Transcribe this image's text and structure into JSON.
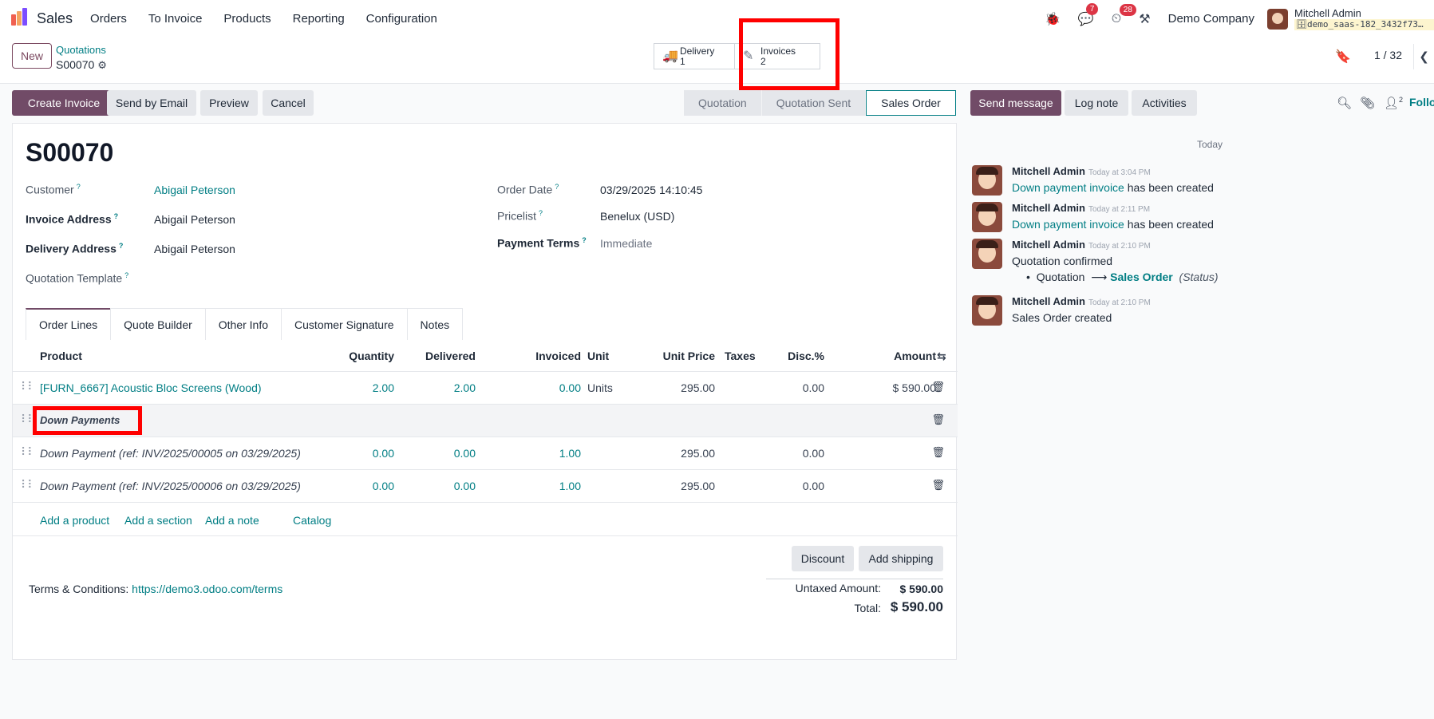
{
  "navbar": {
    "app_name": "Sales",
    "menus": [
      "Orders",
      "To Invoice",
      "Products",
      "Reporting",
      "Configuration"
    ],
    "messages_count": "7",
    "activities_count": "28",
    "company": "Demo Company",
    "user_name": "Mitchell Admin",
    "database": "demo_saas-182_3432f73…"
  },
  "control": {
    "new_label": "New",
    "breadcrumb_parent": "Quotations",
    "record_name": "S00070",
    "delivery_label": "Delivery",
    "delivery_count": "1",
    "invoices_label": "Invoices",
    "invoices_count": "2",
    "pager": "1 / 32"
  },
  "actions": {
    "create_invoice": "Create Invoice",
    "send_email": "Send by Email",
    "preview": "Preview",
    "cancel": "Cancel",
    "stages": [
      "Quotation",
      "Quotation Sent",
      "Sales Order"
    ],
    "active_stage": "Sales Order"
  },
  "chatter_actions": {
    "send_message": "Send message",
    "log_note": "Log note",
    "activities": "Activities",
    "followers_count": "2",
    "follow": "Follo"
  },
  "form": {
    "title": "S00070",
    "customer_label": "Customer",
    "customer": "Abigail Peterson",
    "invoice_address_label": "Invoice Address",
    "invoice_address": "Abigail Peterson",
    "delivery_address_label": "Delivery Address",
    "delivery_address": "Abigail Peterson",
    "quotation_template_label": "Quotation Template",
    "order_date_label": "Order Date",
    "order_date": "03/29/2025 14:10:45",
    "pricelist_label": "Pricelist",
    "pricelist": "Benelux (USD)",
    "payment_terms_label": "Payment Terms",
    "payment_terms": "Immediate"
  },
  "tabs": [
    "Order Lines",
    "Quote Builder",
    "Other Info",
    "Customer Signature",
    "Notes"
  ],
  "table": {
    "headers": {
      "product": "Product",
      "quantity": "Quantity",
      "delivered": "Delivered",
      "invoiced": "Invoiced",
      "unit": "Unit",
      "unit_price": "Unit Price",
      "taxes": "Taxes",
      "disc": "Disc.%",
      "amount": "Amount"
    },
    "rows": [
      {
        "product": "[FURN_6667] Acoustic Bloc Screens (Wood)",
        "quantity": "2.00",
        "delivered": "2.00",
        "invoiced": "0.00",
        "unit": "Units",
        "unit_price": "295.00",
        "disc": "0.00",
        "amount": "$ 590.00"
      },
      {
        "section": "Down Payments"
      },
      {
        "product": "Down Payment (ref: INV/2025/00005 on 03/29/2025)",
        "quantity": "0.00",
        "delivered": "0.00",
        "invoiced": "1.00",
        "unit_price": "295.00",
        "disc": "0.00"
      },
      {
        "product": "Down Payment (ref: INV/2025/00006 on 03/29/2025)",
        "quantity": "0.00",
        "delivered": "0.00",
        "invoiced": "1.00",
        "unit_price": "295.00",
        "disc": "0.00"
      }
    ],
    "add_product": "Add a product",
    "add_section": "Add a section",
    "add_note": "Add a note",
    "catalog": "Catalog"
  },
  "footer": {
    "discount": "Discount",
    "add_shipping": "Add shipping",
    "terms_label": "Terms & Conditions:",
    "terms_link": "https://demo3.odoo.com/terms",
    "untaxed_label": "Untaxed Amount:",
    "untaxed_value": "$ 590.00",
    "total_label": "Total:",
    "total_value": "$ 590.00"
  },
  "chatter": {
    "today": "Today",
    "messages": [
      {
        "author": "Mitchell Admin",
        "date": "Today at 3:04 PM",
        "link": "Down payment invoice",
        "text": "has been created"
      },
      {
        "author": "Mitchell Admin",
        "date": "Today at 2:11 PM",
        "link": "Down payment invoice",
        "text": "has been created"
      },
      {
        "author": "Mitchell Admin",
        "date": "Today at 2:10 PM",
        "text": "Quotation confirmed",
        "change_from": "Quotation",
        "change_to": "Sales Order",
        "change_field": "(Status)"
      },
      {
        "author": "Mitchell Admin",
        "date": "Today at 2:10 PM",
        "text": "Sales Order created"
      }
    ]
  },
  "colors": {
    "primary": "#714b67",
    "link": "#017e84",
    "badge": "#dc3545",
    "annotation": "#ff0000"
  }
}
